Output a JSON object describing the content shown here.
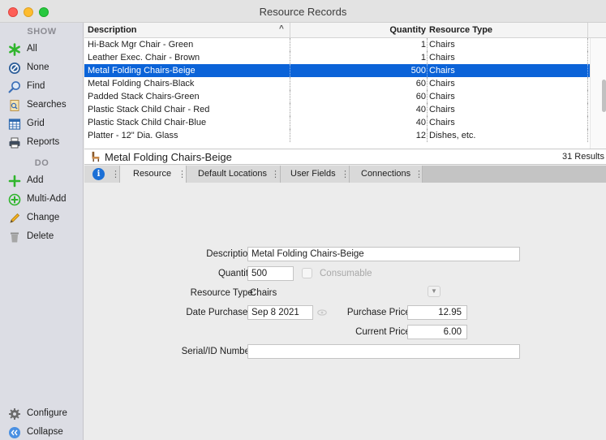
{
  "window": {
    "title": "Resource Records"
  },
  "sidebar": {
    "show_heading": "SHOW",
    "do_heading": "DO",
    "show_items": [
      {
        "label": "All",
        "icon": "asterisk-icon"
      },
      {
        "label": "None",
        "icon": "none-icon"
      },
      {
        "label": "Find",
        "icon": "search-icon"
      },
      {
        "label": "Searches",
        "icon": "saved-searches-icon"
      },
      {
        "label": "Grid",
        "icon": "grid-icon"
      },
      {
        "label": "Reports",
        "icon": "printer-icon"
      }
    ],
    "do_items": [
      {
        "label": "Add",
        "icon": "plus-icon"
      },
      {
        "label": "Multi-Add",
        "icon": "multi-add-icon"
      },
      {
        "label": "Change",
        "icon": "pencil-icon"
      },
      {
        "label": "Delete",
        "icon": "trash-icon"
      }
    ],
    "bottom_items": [
      {
        "label": "Configure",
        "icon": "gear-icon"
      },
      {
        "label": "Collapse",
        "icon": "collapse-icon"
      }
    ]
  },
  "table": {
    "columns": {
      "description": "Description",
      "quantity": "Quantity",
      "type": "Resource Type"
    },
    "sort_indicator": "^",
    "rows": [
      {
        "description": "Hi-Back Mgr Chair - Green",
        "quantity": "1",
        "type": "Chairs"
      },
      {
        "description": "Leather Exec. Chair - Brown",
        "quantity": "1",
        "type": "Chairs"
      },
      {
        "description": "Metal Folding Chairs-Beige",
        "quantity": "500",
        "type": "Chairs"
      },
      {
        "description": "Metal Folding Chairs-Black",
        "quantity": "60",
        "type": "Chairs"
      },
      {
        "description": "Padded Stack Chairs-Green",
        "quantity": "60",
        "type": "Chairs"
      },
      {
        "description": "Plastic Stack Child Chair - Red",
        "quantity": "40",
        "type": "Chairs"
      },
      {
        "description": "Plastic Stack Child Chair-Blue",
        "quantity": "40",
        "type": "Chairs"
      },
      {
        "description": "Platter - 12\" Dia. Glass",
        "quantity": "12",
        "type": "Dishes, etc."
      }
    ],
    "selected_index": 2
  },
  "record": {
    "title": "Metal Folding Chairs-Beige",
    "results": "31 Results"
  },
  "tabs": [
    {
      "label": "Resource",
      "active": true
    },
    {
      "label": "Default Locations",
      "active": false
    },
    {
      "label": "User Fields",
      "active": false
    },
    {
      "label": "Connections",
      "active": false
    }
  ],
  "tab_separator": "⋮",
  "form": {
    "description_label": "Description:",
    "description_value": "Metal Folding Chairs-Beige",
    "quantity_label": "Quantity:",
    "quantity_value": "500",
    "consumable_label": "Consumable",
    "type_label": "Resource Type:",
    "type_value": "Chairs",
    "date_label": "Date Purchased:",
    "date_value": "Sep 8 2021",
    "purchase_price_label": "Purchase Price:",
    "purchase_price_value": "12.95",
    "current_price_label": "Current Price:",
    "current_price_value": "6.00",
    "serial_label": "Serial/ID Number:",
    "serial_value": ""
  },
  "colors": {
    "selection": "#0b63d8",
    "sidebar_bg": "#dcdde4",
    "accent_green": "#2fb52c"
  }
}
